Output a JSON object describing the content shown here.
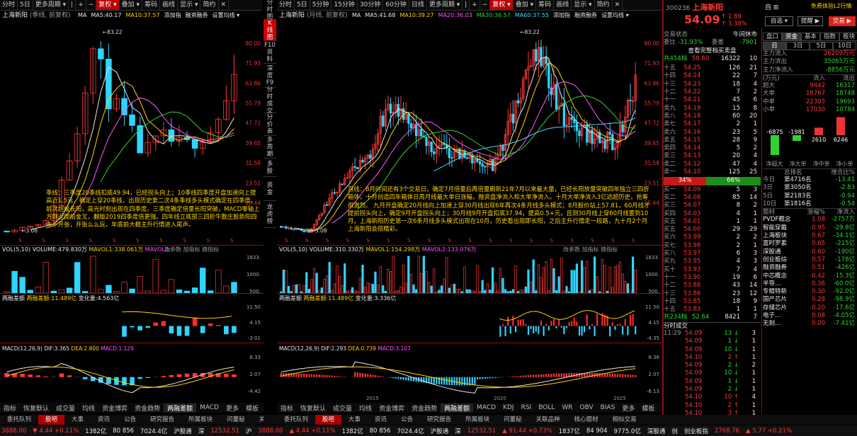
{
  "colors": {
    "up": "#ff3838",
    "down": "#2fd42f",
    "accent": "#cc0000",
    "yellow": "#ffd200"
  },
  "left_chart": {
    "toolbar": [
      "分时",
      "5日",
      "更多周期 ▾",
      "|",
      "+",
      "−",
      "复权 ▾",
      "叠加 ▾",
      "筹码",
      "画线",
      "显示 ▾",
      "简约",
      "✕"
    ],
    "title": "上海新阳",
    "subtitle": "(季线, 前复权)",
    "ma": [
      {
        "t": "MA",
        "c": "wht"
      },
      {
        "t": "MA5:40.17",
        "c": "wht"
      },
      {
        "t": "MA10:37.57",
        "c": "yel"
      },
      {
        "t": "添加指",
        "c": "wht"
      },
      {
        "t": "融资融券",
        "c": "wht"
      },
      {
        "t": "设置均线 ▾",
        "c": "wht"
      }
    ],
    "price_ticks": [
      "80.00",
      "71.93",
      "63.86",
      "55.79",
      "47.72",
      "39.65",
      "31.58",
      "23.51",
      "15.44"
    ],
    "hi_label": "83.22",
    "lo_label": "3.08",
    "note": "季线：三季度20季线扣底49.94，已经拐头向上；10季线四季度开盘加速向上提高近1.5元，确定上穿20季线，出现历史第二次4条季线多头模式确定在四季度，前次超级长阳，高光时刻出现在四季度。三季度确定倍量长阳突破，MACD零轴上方刚近提前金叉，翻版2019四季度倍更强。四年线立底部三四折牛散庄股新阳四年不开张，开张么么玩，年底前大概主升行情进入尾声。",
    "vol_label": "VOL(5,10)",
    "vol_val": "VOLUME:479.830万",
    "vol_ma1": "MAVOL1:338.061万",
    "vol_ma2": "MAVOL2:",
    "vol_ticks": [
      "1833.",
      "1000.",
      "500."
    ],
    "rz_label": "两融差额",
    "rz_val": "两融差额:11.489亿",
    "rz_chg": "变化量:4.563亿",
    "rz_ticks": [
      "11.50",
      "4.15",
      "-3.01"
    ],
    "macd_label": "MACD(12,26,9)",
    "dif": "DIF:3.365",
    "dea": "DEA:2.800",
    "macd": "MACD:1.129",
    "macd_ticks": [
      "8.33",
      "2.07",
      "-4.42"
    ],
    "btabs": [
      "指标",
      "恢复默认",
      "成交量",
      "均线",
      "资金博弈",
      "资金趋势",
      "两融差额",
      "MACD",
      "更多",
      "模板"
    ],
    "mid_labels": [
      "改参数",
      "加指标",
      "换指标"
    ]
  },
  "side_tabs": [
    "分\n时\n图",
    "K\n线\n图",
    "F10\n资\n料",
    "深\n度\nF9",
    "分\n时\n成\n交",
    "分\n价\n表",
    "多\n周\n期",
    "多\n股",
    "资\n金",
    "龙\n虎\n榜"
  ],
  "right_chart": {
    "toolbar": [
      "分时",
      "5日",
      "5分钟",
      "15分钟",
      "30分钟",
      "60分钟",
      "日线",
      "更多周期 ▾",
      "|",
      "+",
      "−",
      "复权 ▾",
      "叠加 ▾",
      "筹码",
      "画线",
      "显示 ▾",
      "简约",
      "✕"
    ],
    "title": "上海新阳",
    "subtitle": "(月线, 前复权)",
    "ma": [
      {
        "t": "MA",
        "c": "wht"
      },
      {
        "t": "MA5:41.68",
        "c": "wht"
      },
      {
        "t": "MA10:39.27",
        "c": "yel"
      },
      {
        "t": "MA20:36.03",
        "c": "mag"
      },
      {
        "t": "MA30:36.57",
        "c": "grn"
      },
      {
        "t": "MA60:37.55",
        "c": "cyn"
      },
      {
        "t": "添加指",
        "c": "wht"
      },
      {
        "t": "融资融券",
        "c": "wht"
      },
      {
        "t": "设置均线 ▾",
        "c": "wht"
      }
    ],
    "hi_label": "83.22",
    "lo_label": "3.08",
    "note": "月线：8月时间还有3个交易日，确定7月倍量后再倍量刷新21年7月以来最大量，已经长阳放量突破四年独立三四折箱体，十月创造四年箱体日周月线最大单日涨幅，融资盘净流入和大单净流入。十月大单净流入3亿远超历史，抢筹很激烈。\n九月开盘确定20月线向上加速上穿30月线出现6年再次4条月线多头模式；8月股价站上57.81，60月线才提前拐头向上，确定9月开盘拐头向上；30月线9月开盘扣底37.94，提高0.5+元，且测30月线上穿60月线要到10月，上海新阳历史第一次6条月线多头模式出现在10月，历史看出现即长阳，之后主升行情走一段路，九十月2个月上海新阳会很精彩。",
    "vol_label": "VOL(5,10)",
    "vol_val": "VOLUME:310.330万",
    "vol_ma1": "MAVOL1:154.298万",
    "vol_ma2": "MAVOL2:133.076万",
    "vol_ticks": [
      "1833.",
      "1000.",
      "500."
    ],
    "rz_label": "两融差额",
    "rz_val": "两融差额:11.489亿",
    "rz_chg": "变化量:3.336亿",
    "rz_ticks": [
      "11.50",
      "4.15",
      "-4.35"
    ],
    "macd_label": "MACD(12,26,9)",
    "dif": "DIF:2.293",
    "dea": "DEA:0.739",
    "macd": "MACD:3.107",
    "macd_ticks": [
      "8.36",
      "2.07",
      "-6.13"
    ],
    "years": [
      "2015",
      "2020",
      "2025"
    ],
    "btabs": [
      "指标",
      "恢复默认",
      "成交量",
      "均线",
      "资金博弈",
      "资金趋势",
      "两融差额",
      "MACD",
      "KDJ",
      "RSI",
      "BOLL",
      "WR",
      "OBV",
      "BIAS",
      "更多",
      "模板"
    ],
    "mid_labels": [
      "改参数",
      "加指标",
      "换指标"
    ]
  },
  "quote": {
    "code": "300236",
    "name": "上海新阳",
    "icons": [
      "自",
      "⊞"
    ],
    "top_link": "免费体验L2行情",
    "price": "54.09",
    "chg": "1.89",
    "pct": "3.38%",
    "btn_pick": "自选 ▾",
    "btn_alert": "提醒 ▶",
    "btn_trade": "交易 ▶",
    "state_l": "交易状态",
    "state_r": "午间休市",
    "wb_l": "委比",
    "wb_v": "-31.93%",
    "wc_l": "委差",
    "wc_v": "-7901",
    "view_all": "查看完整档买卖盘",
    "total_l": "共454档",
    "total_p": "58.60",
    "total_v": "16322",
    "total_n": "10",
    "sells": [
      [
        "十五",
        "54.25",
        "126",
        "21"
      ],
      [
        "十四",
        "54.24",
        "22",
        "7"
      ],
      [
        "十三",
        "54.23",
        "18",
        "4"
      ],
      [
        "十二",
        "54.22",
        "7",
        "2"
      ],
      [
        "十一",
        "54.21",
        "45",
        "6"
      ],
      [
        "卖九",
        "54.19",
        "15",
        "8"
      ],
      [
        "卖八",
        "54.18",
        "60",
        "20"
      ],
      [
        "卖七",
        "54.17",
        "2",
        "1"
      ],
      [
        "卖六",
        "54.16",
        "23",
        "5"
      ],
      [
        "卖五",
        "54.15",
        "28",
        "9"
      ],
      [
        "卖四",
        "54.14",
        "5",
        "2"
      ],
      [
        "卖三",
        "54.13",
        "20",
        "4"
      ],
      [
        "卖二",
        "54.12",
        "47",
        "4"
      ],
      [
        "卖一",
        "54.10",
        "125",
        "25"
      ]
    ],
    "bar_l": "34%",
    "bar_r": "66%",
    "buys": [
      [
        "买一",
        "54.09",
        "5",
        "3"
      ],
      [
        "买二",
        "54.08",
        "85",
        "14"
      ],
      [
        "买三",
        "54.07",
        "8",
        "2"
      ],
      [
        "买四",
        "54.03",
        "4",
        "1"
      ],
      [
        "买五",
        "54.01",
        "1",
        "1"
      ],
      [
        "买五",
        "54.00",
        "29",
        "29"
      ],
      [
        "买六",
        "53.99",
        "2",
        "2"
      ],
      [
        "买七",
        "53.98",
        "2",
        "1"
      ],
      [
        "买八",
        "53.97",
        "6",
        "3"
      ],
      [
        "买九",
        "53.95",
        "4",
        "3"
      ],
      [
        "买十",
        "53.93",
        "7",
        "4"
      ],
      [
        "十一",
        "53.90",
        "19",
        "6"
      ],
      [
        "十二",
        "53.88",
        "43",
        "14"
      ],
      [
        "十三",
        "53.86",
        "23",
        "12"
      ],
      [
        "十四",
        "53.85",
        "18",
        "9"
      ],
      [
        "十五",
        "53.83",
        "1",
        "1"
      ]
    ],
    "total2_l": "共234档",
    "total2_p": "52.64",
    "total2_v": "8421",
    "total2_n": "7",
    "ticks_title": "分时成交",
    "ticks": [
      [
        "11:29",
        "54.09",
        "13",
        "3",
        "grn"
      ],
      [
        "",
        "54.09",
        "1",
        "1",
        "grn"
      ],
      [
        "",
        "54.09",
        "10",
        "1",
        "grn"
      ],
      [
        "",
        "54.10",
        "2",
        "1",
        "red"
      ],
      [
        "",
        "54.09",
        "2",
        "2",
        "grn"
      ],
      [
        "",
        "54.09",
        "10",
        "1",
        "grn"
      ],
      [
        "",
        "54.09",
        "1",
        "1",
        "grn"
      ],
      [
        "",
        "54.09",
        "2",
        "1",
        "grn"
      ],
      [
        "",
        "54.10",
        "10",
        "4",
        "red"
      ],
      [
        "",
        "54.10",
        "2",
        "1",
        "red"
      ],
      [
        "",
        "54.10",
        "3",
        "1",
        "red"
      ],
      [
        "11:30",
        "54.09",
        "7",
        "2",
        "grn"
      ]
    ]
  },
  "fund": {
    "tabs": [
      "盘口",
      "资金",
      "基本",
      "指数",
      "板块"
    ],
    "periods": [
      "日",
      "3日",
      "5日",
      "10日"
    ],
    "in_l": "主力流入",
    "in_v": "26209万元",
    "out_l": "主力流出",
    "out_v": "35065万元",
    "net_l": "主力净流入",
    "net_v": "-8856万元",
    "head": [
      "(万元)",
      "流入",
      "流出"
    ],
    "rows": [
      [
        "超大",
        "9442",
        "16317"
      ],
      [
        "大单",
        "16767",
        "18748"
      ],
      [
        "中单",
        "22303",
        "19693"
      ],
      [
        "小单",
        "17030",
        "10784"
      ]
    ],
    "bars": [
      {
        "v": "-6875",
        "n": -6875
      },
      {
        "v": "-1981",
        "n": -1981
      },
      {
        "v": "2610",
        "n": 2610
      },
      {
        "v": "6246",
        "n": 6246
      }
    ],
    "bar_labels": [
      "净超大",
      "净大单",
      "净中单",
      "净小单"
    ],
    "rank_head": [
      "",
      "总排名",
      "增合比%"
    ],
    "ranks": [
      [
        "今日",
        "第4716名",
        "-13.41"
      ],
      [
        "3日",
        "第3050名",
        "-2.83"
      ],
      [
        "5日",
        "第2183名",
        "-0.94"
      ],
      [
        "10日",
        "第1816名",
        "-0.54"
      ]
    ],
    "sect_head": [
      "题材",
      "涨幅%",
      "净流入"
    ],
    "sects": [
      [
        "PVDF概念",
        "1.08",
        "-2757万"
      ],
      [
        "智能穿戴",
        "0.95",
        "-29.8亿"
      ],
      [
        "上海板块",
        "0.67",
        "-34.1亿"
      ],
      [
        "富时罗素",
        "0.65",
        "-215亿"
      ],
      [
        "深股通",
        "0.60",
        "-190亿"
      ],
      [
        "创业板综",
        "0.57",
        "-178亿"
      ],
      [
        "融资融券",
        "0.51",
        "-426亿"
      ],
      [
        "中芯概念",
        "0.42",
        "-15.3亿"
      ],
      [
        "半导…",
        "0.36",
        "-60.0亿"
      ],
      [
        "专精特新",
        "0.30",
        "-92.0亿"
      ],
      [
        "国产芯片",
        "0.28",
        "-98.9亿"
      ],
      [
        "存储芯片",
        "0.20",
        "-17.6亿"
      ],
      [
        "电子…",
        "0.08",
        "-4.05亿"
      ],
      [
        "无刻…",
        "0.00",
        "-7.41亿"
      ]
    ]
  },
  "status": {
    "left_tabs": [
      "委托队列",
      "股吧",
      "大事",
      "资讯",
      "公告",
      "研究报告",
      "所属板块",
      "问董秘",
      "关系"
    ],
    "right_tabs": [
      "委托队列",
      "股吧",
      "大事",
      "资讯",
      "公告",
      "研究报告",
      "所属板块",
      "问董秘",
      "关联品种",
      "核心题材",
      "相似交易"
    ],
    "items": [
      {
        "t": "3888.00",
        "c": "red"
      },
      {
        "t": "▼ 4.44 +0.11%",
        "c": "red"
      },
      {
        "t": "1382亿",
        "c": "wht"
      },
      {
        "t": "80 856",
        "c": "wht"
      },
      {
        "t": "7024.4亿",
        "c": "wht"
      },
      {
        "t": "沪股通",
        "c": "wht"
      },
      {
        "t": "深",
        "c": "wht"
      },
      {
        "t": "12532.51",
        "c": "red"
      },
      {
        "t": "沪",
        "c": "wht"
      },
      {
        "t": "3888.00",
        "c": "red"
      },
      {
        "t": "▲ 4.44 +0.11%",
        "c": "red"
      },
      {
        "t": "1382亿",
        "c": "wht"
      },
      {
        "t": "80 856",
        "c": "wht"
      },
      {
        "t": "7024.4亿",
        "c": "wht"
      },
      {
        "t": "沪股通",
        "c": "wht"
      },
      {
        "t": "深",
        "c": "wht"
      },
      {
        "t": "12532.51",
        "c": "red"
      },
      {
        "t": "▲ 91.44 +0.73%",
        "c": "red"
      },
      {
        "t": "1837亿",
        "c": "wht"
      },
      {
        "t": "84 904",
        "c": "wht"
      },
      {
        "t": "9775.0亿",
        "c": "wht"
      },
      {
        "t": "深股通",
        "c": "wht"
      },
      {
        "t": "创",
        "c": "wht"
      },
      {
        "t": "创业板指",
        "c": "wht"
      },
      {
        "t": "2768.76",
        "c": "red"
      },
      {
        "t": "▲ 5.77 +0.21%",
        "c": "red"
      }
    ]
  }
}
